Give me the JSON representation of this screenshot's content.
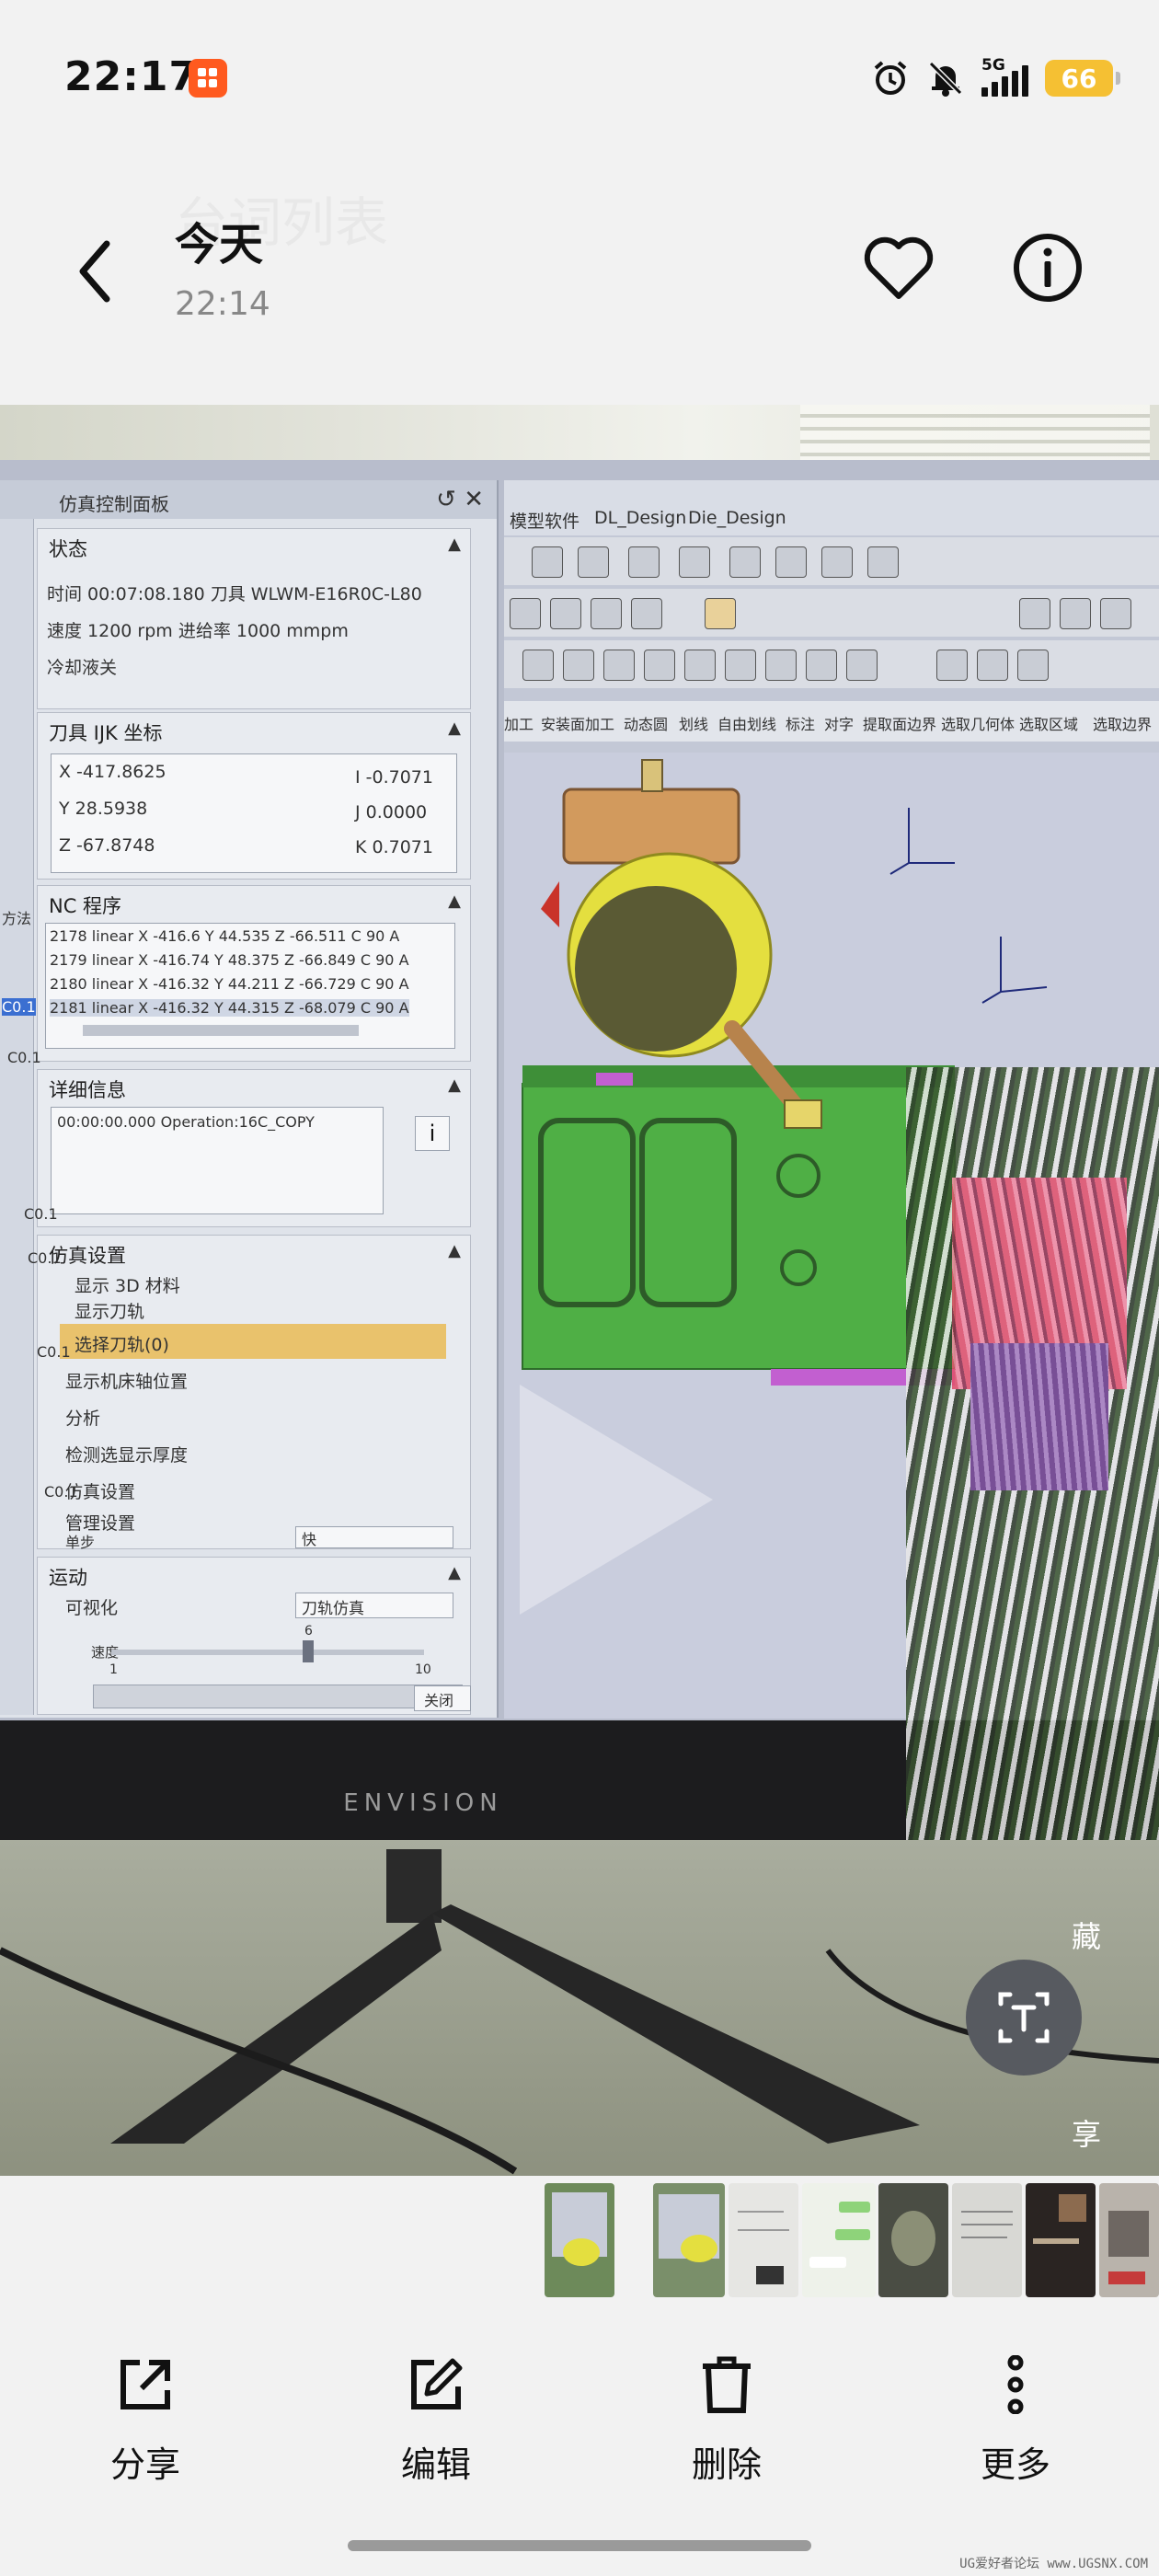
{
  "status": {
    "time": "22:17",
    "network": "5G",
    "battery": "66"
  },
  "header": {
    "title": "今天",
    "time": "22:14",
    "ghost_text": "台词列表"
  },
  "photo": {
    "sim_panel": {
      "title": "仿真控制面板",
      "status_section": "状态",
      "status_line1": "时间 00:07:08.180 刀具 WLWM-E16R0C-L80",
      "status_line2": "速度 1200 rpm    进给率 1000 mmpm",
      "status_line3": "冷却液关",
      "ijk_section": "刀具 IJK 坐标",
      "x_val": "X -417.8625",
      "y_val": "Y 28.5938",
      "z_val": "Z -67.8748",
      "i_val": "I -0.7071",
      "j_val": "J 0.0000",
      "k_val": "K 0.7071",
      "nc_section": "NC 程序",
      "nc_lines": [
        "2178 linear X -416.6 Y 44.535 Z -66.511 C 90 A",
        "2179 linear X -416.74 Y 48.375 Z -66.849 C 90 A",
        "2180 linear X -416.32 Y 44.211 Z -66.729 C 90 A",
        "2181 linear X -416.32 Y 44.315 Z -68.079 C 90 A"
      ],
      "detail_section": "详细信息",
      "detail_text": "00:00:00.000 Operation:16C_COPY",
      "sim_section": "仿真设置",
      "opt1": "显示 3D 材料",
      "opt2": "显示刀轨",
      "highlight": "选择刀轨(0)",
      "opt3": "显示机床轴位置",
      "opt4": "分析",
      "opt5": "检测选显示厚度",
      "opt6": "仿真设置",
      "opt7": "管理设置",
      "step_label": "单步",
      "step_value": "快",
      "motion_section": "运动",
      "visual_label": "可视化",
      "visual_value": "刀轨仿真",
      "speed_label": "速度",
      "speed_min": "1",
      "speed_mid": "6",
      "speed_max": "10",
      "close_label": "关闭"
    },
    "left_strip": [
      "方法",
      "C0.1",
      "C0.1",
      "C0.1",
      "C0.1",
      "C0.1",
      "C0.1"
    ],
    "cad": {
      "menu": [
        "模型软件",
        "DL_Design",
        "Die_Design"
      ],
      "tabs": [
        "加工",
        "安装面加工",
        "动态圆",
        "划线",
        "自由划线",
        "标注",
        "对字",
        "提取面边界",
        "选取几何体",
        "选取区域",
        "选取边界"
      ]
    },
    "monitor_brand": "ENVISION",
    "side_labels": [
      "藏",
      "享"
    ]
  },
  "thumbnails": [
    {
      "name": "thumb-cad-1",
      "color": "#6d8a5a"
    },
    {
      "name": "thumb-cad-2",
      "color": "#7a8f6a"
    },
    {
      "name": "thumb-paper",
      "color": "#e6e6e3"
    },
    {
      "name": "thumb-chat",
      "color": "#eef2ea"
    },
    {
      "name": "thumb-dark-circle",
      "color": "#4a4d44"
    },
    {
      "name": "thumb-doc",
      "color": "#d8d8d4"
    },
    {
      "name": "thumb-dark-chat",
      "color": "#2a2422"
    },
    {
      "name": "thumb-machine",
      "color": "#b9b3ab"
    }
  ],
  "actions": {
    "share": "分享",
    "edit": "编辑",
    "delete": "删除",
    "more": "更多"
  },
  "watermark": "UG爱好者论坛 www.UGSNX.COM"
}
